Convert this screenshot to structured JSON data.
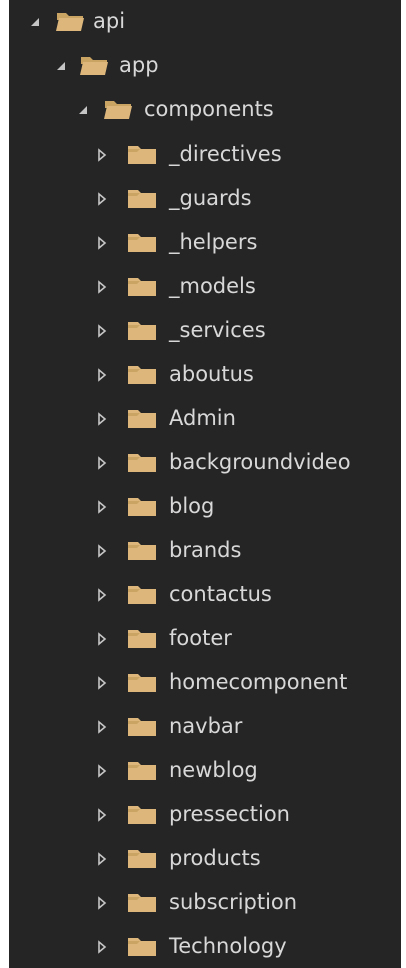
{
  "explorer": {
    "root": {
      "label": "api",
      "expanded": true
    },
    "app": {
      "label": "app",
      "expanded": true
    },
    "components": {
      "label": "components",
      "expanded": true
    },
    "children": [
      {
        "label": "_directives"
      },
      {
        "label": "_guards"
      },
      {
        "label": "_helpers"
      },
      {
        "label": "_models"
      },
      {
        "label": "_services"
      },
      {
        "label": "aboutus"
      },
      {
        "label": "Admin"
      },
      {
        "label": "backgroundvideo"
      },
      {
        "label": "blog"
      },
      {
        "label": "brands"
      },
      {
        "label": "contactus"
      },
      {
        "label": "footer"
      },
      {
        "label": "homecomponent"
      },
      {
        "label": "navbar"
      },
      {
        "label": "newblog"
      },
      {
        "label": "pressection"
      },
      {
        "label": "products"
      },
      {
        "label": "subscription"
      },
      {
        "label": "Technology"
      }
    ]
  },
  "colors": {
    "background": "#252526",
    "text": "#d8d8d8",
    "folder": "#dcb67a",
    "twisty": "#c5c5c5"
  },
  "icons": {
    "expanded_twisty": "triangle-expanded-icon",
    "collapsed_twisty": "triangle-collapsed-icon",
    "open_folder": "folder-open-icon",
    "closed_folder": "folder-closed-icon"
  }
}
